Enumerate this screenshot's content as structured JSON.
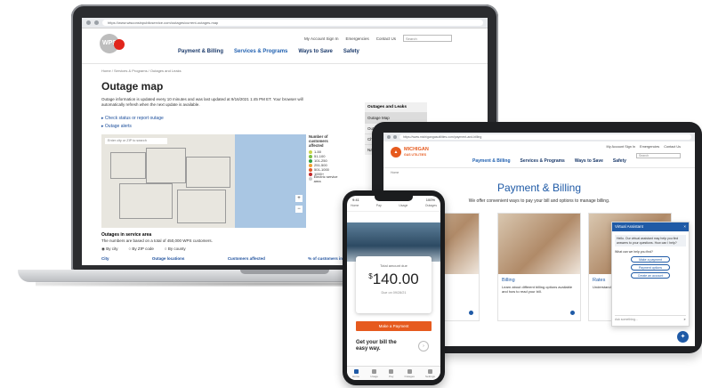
{
  "laptop": {
    "url": "https://www.wisconsinpublicservice.com/outages/current-outages-map",
    "logo": "WPS",
    "util": {
      "account": "My Account Sign In",
      "emergencies": "Emergencies",
      "contact": "Contact Us",
      "search_placeholder": "Search"
    },
    "nav": [
      "Payment & Billing",
      "Services & Programs",
      "Ways to Save",
      "Safety"
    ],
    "breadcrumb": "Home / Services & Programs / Outages and Leaks",
    "title": "Outage map",
    "description": "Outage information is updated every 10 minutes and was last updated at 9/16/2021 1:45 PM ET. Your browser will automatically refresh when the next update is available.",
    "links": [
      "Check status or report outage",
      "Outage alerts"
    ],
    "map_search_placeholder": "Enter city or ZIP to search",
    "legend": {
      "title": "Number of customers affected",
      "items": [
        {
          "label": "1-50",
          "color": "#c8d44a"
        },
        {
          "label": "51-100",
          "color": "#7bbf44"
        },
        {
          "label": "101-250",
          "color": "#2f9e44"
        },
        {
          "label": "251-500",
          "color": "#f0a030"
        },
        {
          "label": "501-1000",
          "color": "#e2592a"
        },
        {
          "label": "1000+",
          "color": "#c1272d"
        },
        {
          "label": "Electric service area",
          "color": "#cccccc"
        }
      ]
    },
    "service_area_title": "Outages in service area",
    "service_area_desc": "The numbers are based on a total of 450,000 WPS customers.",
    "radios": [
      "By city",
      "By ZIP code",
      "By county"
    ],
    "table_headers": [
      "City",
      "Outage locations",
      "Customers affected",
      "% of customers in city"
    ],
    "sidepanel": {
      "heading": "Outages and Leaks",
      "items": [
        "Outage Map",
        "Outage Alerts",
        "Check Status or Report Outage",
        "Natural Gas Emergencies"
      ]
    }
  },
  "tablet": {
    "url": "https://www.michigangasutilities.com/payment-and-billing",
    "logo_line1": "MICHIGAN",
    "logo_line2": "GAS UTILITIES",
    "util": {
      "account": "My Account Sign In",
      "emergencies": "Emergencies",
      "contact": "Contact Us",
      "search_placeholder": "Search"
    },
    "nav": [
      "Payment & Billing",
      "Services & Programs",
      "Ways to Save",
      "Safety"
    ],
    "home": "Home",
    "hero_title": "Payment & Billing",
    "hero_subtitle": "We offer convenient ways to pay your bill and options to manage billing.",
    "cards": [
      {
        "title": "",
        "desc": "convenient ways to"
      },
      {
        "title": "Billing",
        "desc": "Learn about different billing options available and how to read your bill."
      },
      {
        "title": "Rates",
        "desc": "Understand"
      }
    ],
    "chat": {
      "title": "Virtual Assistant",
      "greeting": "Hello. Our virtual assistant may help you find answers to your questions. How can I help?",
      "question": "What can we help you find?",
      "options": [
        "Make a payment",
        "Payment options",
        "Create an account"
      ],
      "input_placeholder": "Ask something..."
    }
  },
  "phone": {
    "time": "9:41",
    "battery": "100%",
    "tabs": [
      "Home",
      "Pay",
      "Usage",
      "Outages"
    ],
    "amount_label": "Total amount due",
    "currency": "$",
    "amount": "140.00",
    "due": "Due on 09/28/21",
    "pay_button": "Make a Payment",
    "bill_promo_line1": "Get your bill the",
    "bill_promo_line2": "easy way.",
    "bottom_nav": [
      "Home",
      "Usage",
      "Pay",
      "Outages",
      "Settings"
    ]
  }
}
